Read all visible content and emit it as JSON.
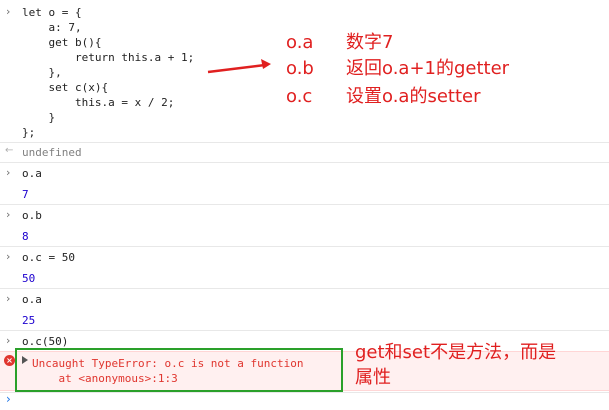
{
  "console": {
    "input_block": [
      "let o = {",
      "    a: 7,",
      "    get b(){",
      "        return this.a + 1;",
      "    },",
      "    set c(x){",
      "        this.a = x / 2;",
      "    }",
      "};"
    ],
    "entries": [
      {
        "kind": "result",
        "text": "undefined"
      },
      {
        "kind": "input",
        "text": "o.a"
      },
      {
        "kind": "result",
        "text": "7"
      },
      {
        "kind": "input",
        "text": "o.b"
      },
      {
        "kind": "result",
        "text": "8"
      },
      {
        "kind": "input",
        "text": "o.c = 50"
      },
      {
        "kind": "result",
        "text": "50"
      },
      {
        "kind": "input",
        "text": "o.a"
      },
      {
        "kind": "result",
        "text": "25"
      },
      {
        "kind": "input",
        "text": "o.c(50)"
      }
    ],
    "error": {
      "line1": "Uncaught TypeError: o.c is not a function",
      "line2": "    at <anonymous>:1:3"
    }
  },
  "annotations": {
    "oa_key": "o.a",
    "oa_desc": "数字7",
    "ob_key": "o.b",
    "ob_desc": "返回o.a+1的getter",
    "oc_key": "o.c",
    "oc_desc": "设置o.a的setter",
    "note_line1": "get和set不是方法，而是",
    "note_line2": "属性"
  },
  "colors": {
    "annotation": "#e02020",
    "error": "#e0362f",
    "highlight_box": "#2aa02a"
  }
}
